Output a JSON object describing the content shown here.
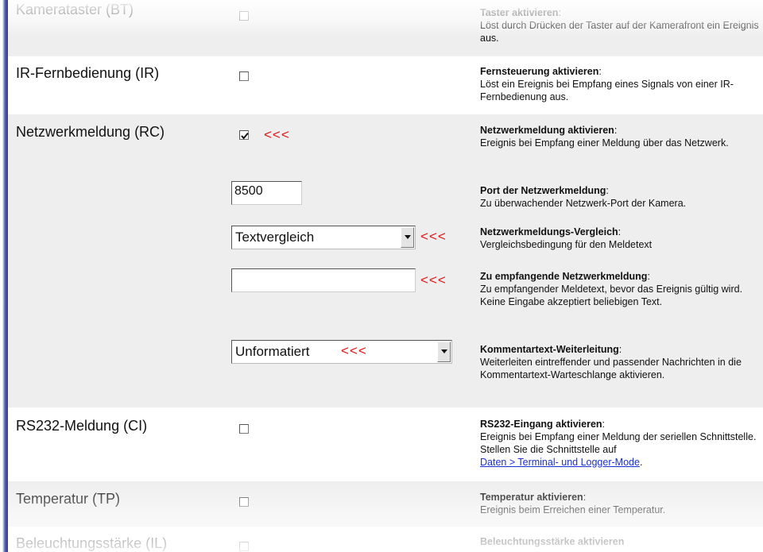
{
  "rows": {
    "kamerataster": {
      "label": "Kamerataster (BT)",
      "desc_head": "Taster aktivieren",
      "desc_text": "Löst durch Drücken der Taster auf der Kamerafront ein Ereignis aus.",
      "checked": false
    },
    "ir": {
      "label": "IR-Fernbedienung (IR)",
      "desc_head": "Fernsteuerung aktivieren",
      "desc_text": "Löst ein Ereignis bei Empfang eines Signals von einer IR-Fernbedienung aus.",
      "checked": false
    },
    "netzwerk": {
      "label": "Netzwerkmeldung (RC)",
      "desc_head": "Netzwerkmeldung aktivieren",
      "desc_text": "Ereignis bei Empfang einer Meldung über das Netzwerk.",
      "checked": true,
      "marker": "<<<"
    },
    "port": {
      "value": "8500",
      "desc_head": "Port der Netzwerkmeldung",
      "desc_text": "Zu überwachender Netzwerk-Port der Kamera."
    },
    "vergleich": {
      "selected": "Textvergleich",
      "desc_head": "Netzwerkmeldungs-Vergleich",
      "desc_text": "Vergleichsbedingung für den Meldetext",
      "marker": "<<<"
    },
    "meldetext": {
      "value": "",
      "desc_head": "Zu empfangende Netzwerkmeldung",
      "desc_text": "Zu empfangender Meldetext, bevor das Ereignis gültig wird. Keine Eingabe akzeptiert beliebigen Text.",
      "marker": "<<<"
    },
    "kommentar": {
      "selected": "Unformatiert",
      "desc_head": "Kommentartext-Weiterleitung",
      "desc_text": "Weiterleiten eintreffender und passender Nachrichten in die Kommentartext-Warteschlange aktivieren.",
      "marker": "<<<"
    },
    "rs232": {
      "label": "RS232-Meldung (CI)",
      "desc_head": "RS232-Eingang aktivieren",
      "desc_text": "Ereignis bei Empfang einer Meldung der seriellen Schnittstelle. Stellen Sie die Schnittstelle auf",
      "link": "Daten > Terminal- und Logger-Mode",
      "checked": false
    },
    "temperatur": {
      "label": "Temperatur (TP)",
      "desc_head": "Temperatur aktivieren",
      "desc_text": "Ereignis beim Erreichen einer Temperatur.",
      "checked": false
    },
    "beleuchtung": {
      "label": "Beleuchtungsstärke (IL)",
      "desc_head": "Beleuchtungsstärke aktivieren",
      "checked": false
    }
  },
  "colors": {
    "shaded_row": "#eeeeee",
    "marker": "#e11717",
    "link": "#1a2fd6",
    "left_bar": "#343c8e"
  }
}
